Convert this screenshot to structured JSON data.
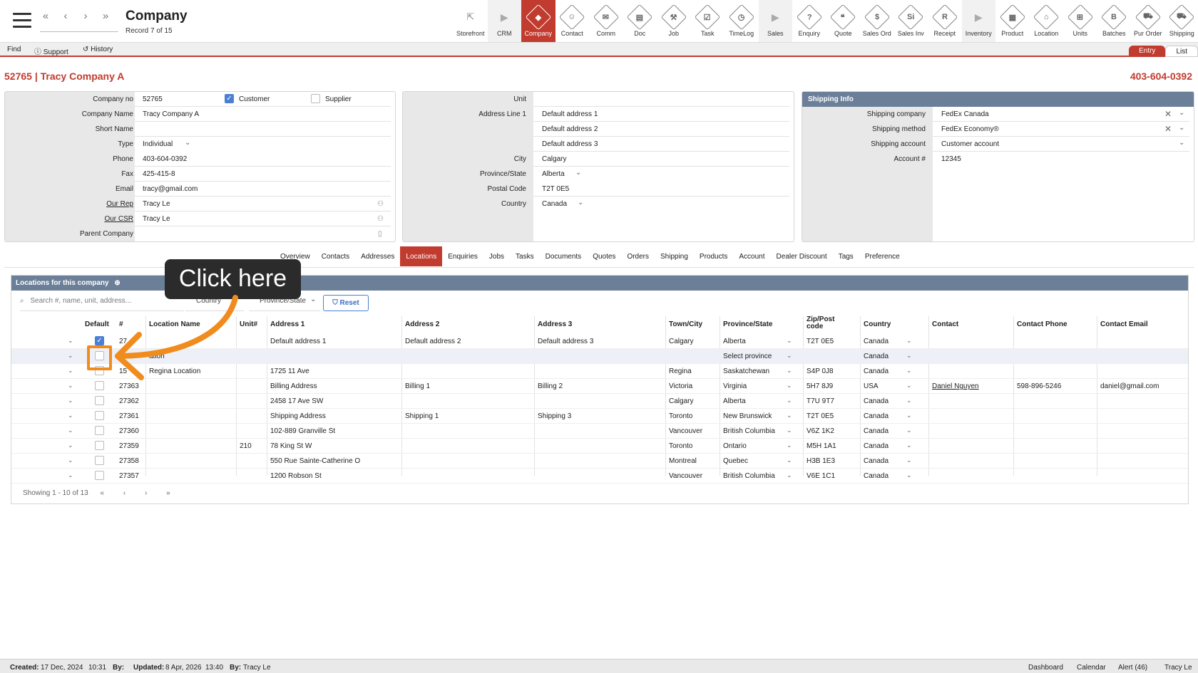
{
  "header": {
    "title": "Company",
    "record": "Record 7 of 15",
    "nav": [
      "«",
      "‹",
      "›",
      "»"
    ]
  },
  "modules": [
    {
      "label": "Storefront",
      "glyph": "⇱",
      "kind": "ext"
    },
    {
      "label": "CRM",
      "glyph": "▶",
      "kind": "arr"
    },
    {
      "label": "Company",
      "glyph": "◆",
      "kind": "active"
    },
    {
      "label": "Contact",
      "glyph": "☺",
      "kind": "dia"
    },
    {
      "label": "Comm",
      "glyph": "✉",
      "kind": "dia"
    },
    {
      "label": "Doc",
      "glyph": "▤",
      "kind": "dia"
    },
    {
      "label": "Job",
      "glyph": "⚒",
      "kind": "dia"
    },
    {
      "label": "Task",
      "glyph": "☑",
      "kind": "dia"
    },
    {
      "label": "TimeLog",
      "glyph": "◷",
      "kind": "dia"
    },
    {
      "label": "Sales",
      "glyph": "▶",
      "kind": "arr"
    },
    {
      "label": "Enquiry",
      "glyph": "?",
      "kind": "dia"
    },
    {
      "label": "Quote",
      "glyph": "❝",
      "kind": "dia"
    },
    {
      "label": "Sales Ord",
      "glyph": "$",
      "kind": "dia"
    },
    {
      "label": "Sales Inv",
      "glyph": "Si",
      "kind": "dia"
    },
    {
      "label": "Receipt",
      "glyph": "R",
      "kind": "dia"
    },
    {
      "label": "Inventory",
      "glyph": "▶",
      "kind": "arr"
    },
    {
      "label": "Product",
      "glyph": "▦",
      "kind": "dia"
    },
    {
      "label": "Location",
      "glyph": "⌂",
      "kind": "dia"
    },
    {
      "label": "Units",
      "glyph": "⊞",
      "kind": "dia"
    },
    {
      "label": "Batches",
      "glyph": "B",
      "kind": "dia"
    },
    {
      "label": "Pur Order",
      "glyph": "⛟",
      "kind": "dia"
    },
    {
      "label": "Shipping",
      "glyph": "⛟",
      "kind": "dia"
    }
  ],
  "toolbar": {
    "find": "Find",
    "support": "Support",
    "history": "History",
    "entry": "Entry",
    "list": "List"
  },
  "company": {
    "heading": "52765 | Tracy Company A",
    "phone_heading": "403-604-0392"
  },
  "details": {
    "company_no_label": "Company no",
    "company_no": "52765",
    "customer_label": "Customer",
    "supplier_label": "Supplier",
    "name_label": "Company Name",
    "name": "Tracy Company A",
    "short_label": "Short Name",
    "short": "",
    "type_label": "Type",
    "type": "Individual",
    "phone_label": "Phone",
    "phone": "403-604-0392",
    "fax_label": "Fax",
    "fax": "425-415-8",
    "email_label": "Email",
    "email": "tracy@gmail.com",
    "rep_label": "Our Rep",
    "rep": "Tracy Le",
    "csr_label": "Our CSR",
    "csr": "Tracy Le",
    "parent_label": "Parent Company",
    "parent": ""
  },
  "address": {
    "unit_label": "Unit",
    "unit": "",
    "line1_label": "Address Line 1",
    "line1": "Default address 1",
    "line2": "Default address 2",
    "line3": "Default address 3",
    "city_label": "City",
    "city": "Calgary",
    "prov_label": "Province/State",
    "prov": "Alberta",
    "postal_label": "Postal Code",
    "postal": "T2T 0E5",
    "country_label": "Country",
    "country": "Canada"
  },
  "shipping": {
    "title": "Shipping Info",
    "company_label": "Shipping company",
    "company": "FedEx Canada",
    "method_label": "Shipping method",
    "method": "FedEx Economy®",
    "account_label": "Shipping account",
    "account": "Customer account",
    "acctno_label": "Account #",
    "acctno": "12345"
  },
  "tabs": [
    "Overview",
    "Contacts",
    "Addresses",
    "Locations",
    "Enquiries",
    "Jobs",
    "Tasks",
    "Documents",
    "Quotes",
    "Orders",
    "Shipping",
    "Products",
    "Account",
    "Dealer Discount",
    "Tags",
    "Preference"
  ],
  "locations": {
    "title": "Locations for this company",
    "search_placeholder": "Search #, name, unit, address...",
    "country_filter": "Country",
    "prov_filter": "Province/State",
    "reset": "Reset",
    "columns": [
      "Default",
      "#",
      "Location Name",
      "Unit#",
      "Address 1",
      "Address 2",
      "Address 3",
      "Town/City",
      "Province/State",
      "Zip/Post code",
      "Country",
      "Contact",
      "Contact Phone",
      "Contact Email"
    ],
    "rows": [
      {
        "def": true,
        "id": "27",
        "name": "",
        "unit": "",
        "a1": "Default address 1",
        "a2": "Default address 2",
        "a3": "Default address 3",
        "city": "Calgary",
        "prov": "Alberta",
        "zip": "T2T 0E5",
        "country": "Canada",
        "contact": "",
        "cphone": "",
        "cemail": ""
      },
      {
        "def": false,
        "id": "",
        "name": "ation",
        "unit": "",
        "a1": "",
        "a2": "",
        "a3": "",
        "city": "",
        "prov": "Select province",
        "zip": "",
        "country": "Canada",
        "contact": "",
        "cphone": "",
        "cemail": ""
      },
      {
        "def": false,
        "id": "15",
        "name": "Regina Location",
        "unit": "",
        "a1": "1725 11 Ave",
        "a2": "",
        "a3": "",
        "city": "Regina",
        "prov": "Saskatchewan",
        "zip": "S4P 0J8",
        "country": "Canada",
        "contact": "",
        "cphone": "",
        "cemail": ""
      },
      {
        "def": false,
        "id": "27363",
        "name": "",
        "unit": "",
        "a1": "Billing Address",
        "a2": "Billing 1",
        "a3": "Billing 2",
        "city": "Victoria",
        "prov": "Virginia",
        "zip": "5H7 8J9",
        "country": "USA",
        "contact": "Daniel Nguyen",
        "cphone": "598-896-5246",
        "cemail": "daniel@gmail.com"
      },
      {
        "def": false,
        "id": "27362",
        "name": "",
        "unit": "",
        "a1": "2458 17 Ave SW",
        "a2": "",
        "a3": "",
        "city": "Calgary",
        "prov": "Alberta",
        "zip": "T7U 9T7",
        "country": "Canada",
        "contact": "",
        "cphone": "",
        "cemail": ""
      },
      {
        "def": false,
        "id": "27361",
        "name": "",
        "unit": "",
        "a1": "Shipping Address",
        "a2": "Shipping 1",
        "a3": "Shipping 3",
        "city": "Toronto",
        "prov": "New Brunswick",
        "zip": "T2T 0E5",
        "country": "Canada",
        "contact": "",
        "cphone": "",
        "cemail": ""
      },
      {
        "def": false,
        "id": "27360",
        "name": "",
        "unit": "",
        "a1": "102-889 Granville St",
        "a2": "",
        "a3": "",
        "city": "Vancouver",
        "prov": "British Columbia",
        "zip": "V6Z 1K2",
        "country": "Canada",
        "contact": "",
        "cphone": "",
        "cemail": ""
      },
      {
        "def": false,
        "id": "27359",
        "name": "",
        "unit": "210",
        "a1": "78 King St W",
        "a2": "",
        "a3": "",
        "city": "Toronto",
        "prov": "Ontario",
        "zip": "M5H 1A1",
        "country": "Canada",
        "contact": "",
        "cphone": "",
        "cemail": ""
      },
      {
        "def": false,
        "id": "27358",
        "name": "",
        "unit": "",
        "a1": "550 Rue Sainte-Catherine O",
        "a2": "",
        "a3": "",
        "city": "Montreal",
        "prov": "Quebec",
        "zip": "H3B 1E3",
        "country": "Canada",
        "contact": "",
        "cphone": "",
        "cemail": ""
      },
      {
        "def": false,
        "id": "27357",
        "name": "",
        "unit": "",
        "a1": "1200 Robson St",
        "a2": "",
        "a3": "",
        "city": "Vancouver",
        "prov": "British Columbia",
        "zip": "V6E 1C1",
        "country": "Canada",
        "contact": "",
        "cphone": "",
        "cemail": ""
      }
    ],
    "pager_text": "Showing 1 - 10 of 13",
    "pager": [
      "«",
      "‹",
      "›",
      "»"
    ]
  },
  "callout": "Click here",
  "footer": {
    "created_label": "Created:",
    "created": "17 Dec, 2024",
    "created_time": "10:31",
    "by1_label": "By:",
    "by1": "",
    "updated_label": "Updated:",
    "updated": "8 Apr, 2026",
    "updated_time": "13:40",
    "by2_label": "By:",
    "by2": "Tracy Le",
    "dashboard": "Dashboard",
    "calendar": "Calendar",
    "alert": "Alert (46)",
    "user": "Tracy Le"
  },
  "colors": {
    "accent": "#c13b2f",
    "header_bar": "#6b7f99",
    "highlight": "#f08c1e",
    "check": "#4a7fd4"
  }
}
